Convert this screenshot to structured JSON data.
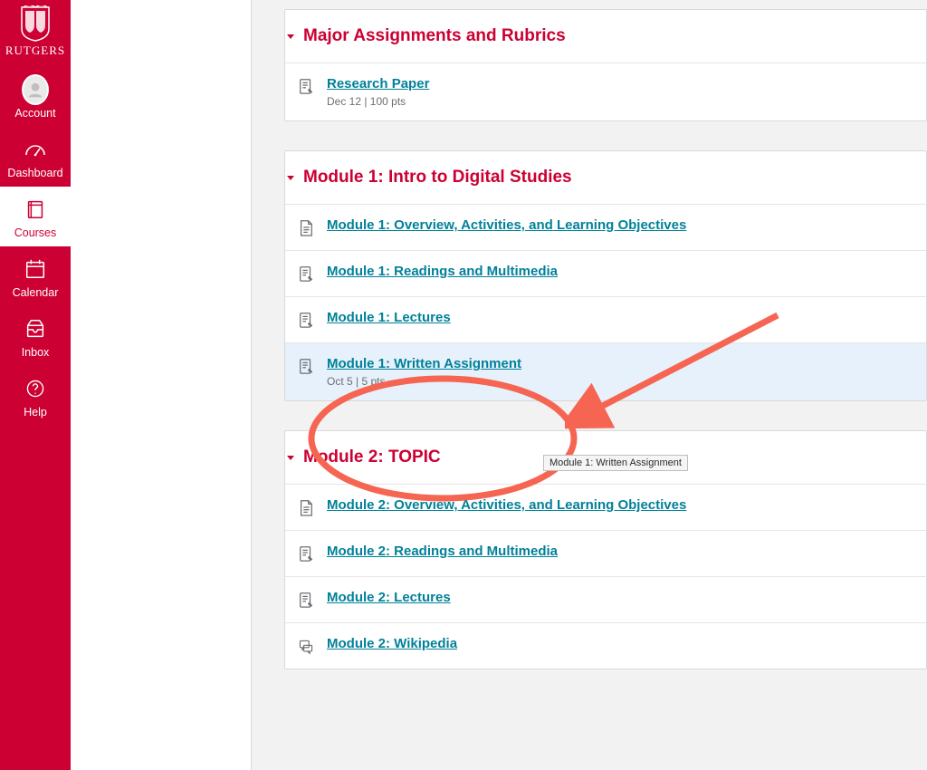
{
  "brand": {
    "name": "RUTGERS"
  },
  "nav": {
    "account": {
      "label": "Account"
    },
    "dashboard": {
      "label": "Dashboard"
    },
    "courses": {
      "label": "Courses"
    },
    "calendar": {
      "label": "Calendar"
    },
    "inbox": {
      "label": "Inbox"
    },
    "help": {
      "label": "Help"
    }
  },
  "modules": [
    {
      "title": "Major Assignments and Rubrics",
      "items": [
        {
          "icon": "assignment",
          "label": "Research Paper",
          "meta": "Dec 12  |  100 pts"
        }
      ]
    },
    {
      "title": "Module 1: Intro to Digital Studies",
      "items": [
        {
          "icon": "page",
          "label": "Module 1: Overview, Activities, and Learning Objectives"
        },
        {
          "icon": "assignment",
          "label": "Module 1: Readings and Multimedia"
        },
        {
          "icon": "assignment",
          "label": "Module 1: Lectures"
        },
        {
          "icon": "assignment",
          "label": "Module 1: Written Assignment",
          "meta": "Oct 5  |  5 pts",
          "highlight": true
        }
      ]
    },
    {
      "title": "Module 2: TOPIC",
      "items": [
        {
          "icon": "page",
          "label": "Module 2: Overview, Activities, and Learning Objectives"
        },
        {
          "icon": "assignment",
          "label": "Module 2: Readings and Multimedia"
        },
        {
          "icon": "assignment",
          "label": "Module 2: Lectures"
        },
        {
          "icon": "discussion",
          "label": "Module 2: Wikipedia"
        }
      ]
    }
  ],
  "tooltip": {
    "text": "Module 1: Written Assignment"
  }
}
